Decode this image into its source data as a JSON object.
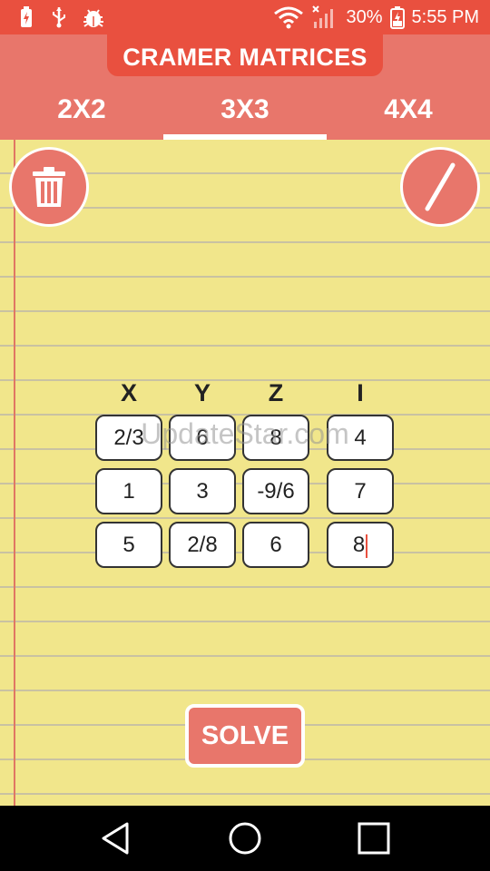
{
  "status_bar": {
    "battery_percent": "30%",
    "time": "5:55 PM",
    "icons": [
      "battery-charging-icon",
      "usb-icon",
      "android-debug-icon",
      "wifi-icon",
      "cellular-signal-icon",
      "battery-icon"
    ]
  },
  "header": {
    "title": "CRAMER MATRICES",
    "tabs": [
      {
        "label": "2X2",
        "active": false
      },
      {
        "label": "3X3",
        "active": true
      },
      {
        "label": "4X4",
        "active": false
      }
    ]
  },
  "toolbar": {
    "clear_icon": "trash-icon",
    "fraction_icon": "slash-icon"
  },
  "matrix": {
    "headers": [
      "X",
      "Y",
      "Z",
      "I"
    ],
    "rows": [
      [
        "2/3",
        "6",
        "8",
        "4"
      ],
      [
        "1",
        "3",
        "-9/6",
        "7"
      ],
      [
        "5",
        "2/8",
        "6",
        "8"
      ]
    ]
  },
  "watermark": "UpdateStar.com",
  "actions": {
    "solve_label": "SOLVE"
  },
  "nav_bar": {
    "icons": [
      "back-icon",
      "home-icon",
      "recents-icon"
    ]
  },
  "colors": {
    "accent": "#e9503f",
    "header": "#e8766b",
    "paper": "#f1e68b"
  }
}
